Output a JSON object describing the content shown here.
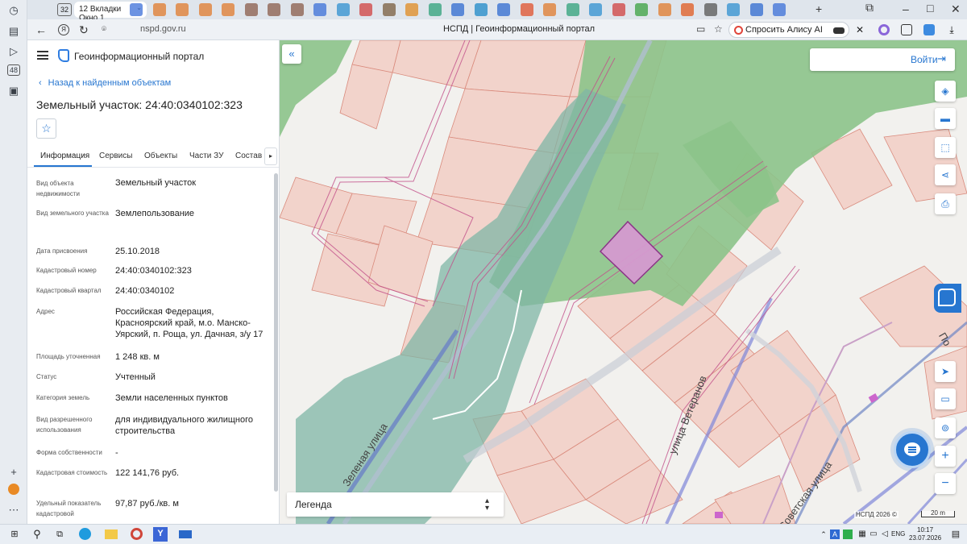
{
  "browser": {
    "tab_count": "32",
    "active_tab_label": "12  Вкладки Окно 1",
    "url": "nspd.gov.ru",
    "page_title": "НСПД | Геоинформационный портал",
    "alice_label": "Спросить Алису AI",
    "colors": {
      "accent": "#2776d0"
    }
  },
  "panel": {
    "portal_name": "Геоинформационный портал",
    "back_link": "Назад к найденным объектам",
    "object_title": "Земельный участок: 24:40:0340102:323",
    "tabs": [
      {
        "label": "Информация"
      },
      {
        "label": "Сервисы"
      },
      {
        "label": "Объекты"
      },
      {
        "label": "Части ЗУ"
      },
      {
        "label": "Состав"
      }
    ],
    "fields": [
      {
        "label": "Вид объекта недвижимости",
        "value": "Земельный участок"
      },
      {
        "label": "Вид земельного участка",
        "value": "Землепользование"
      },
      {
        "label": "Дата присвоения",
        "value": "25.10.2018"
      },
      {
        "label": "Кадастровый номер",
        "value": "24:40:0340102:323"
      },
      {
        "label": "Кадастровый квартал",
        "value": "24:40:0340102"
      },
      {
        "label": "Адрес",
        "value": "Российская Федерация, Красноярский край, м.о. Манско-Уярский, п. Роща, ул. Дачная, з/у 17"
      },
      {
        "label": "Площадь уточненная",
        "value": "1 248 кв. м"
      },
      {
        "label": "Статус",
        "value": "Учтенный"
      },
      {
        "label": "Категория земель",
        "value": "Земли населенных пунктов"
      },
      {
        "label": "Вид разрешенного использования",
        "value": "для индивидуального жилищного строительства"
      },
      {
        "label": "Форма собственности",
        "value": "-"
      },
      {
        "label": "Кадастровая стоимость",
        "value": "122 141,76 руб."
      },
      {
        "label": "Удельный показатель кадастровой",
        "value": "97,87 руб./кв. м"
      }
    ]
  },
  "map": {
    "login_label": "Войти",
    "legend_label": "Легенда",
    "attribution": "НСПД 2026 ©",
    "scale": "20 m",
    "street_labels": [
      "Зеленая улица",
      "улица Ветеранов",
      "Советская улица",
      "По"
    ],
    "controls": [
      "layers-icon",
      "ruler-icon",
      "select-area-icon",
      "share-icon",
      "print-icon",
      "locate-icon",
      "card-icon",
      "geo-icon",
      "zoom-in-icon",
      "zoom-out-icon"
    ]
  },
  "taskbar": {
    "language": "ENG",
    "time": "10:17",
    "date": "23.07.2026"
  }
}
